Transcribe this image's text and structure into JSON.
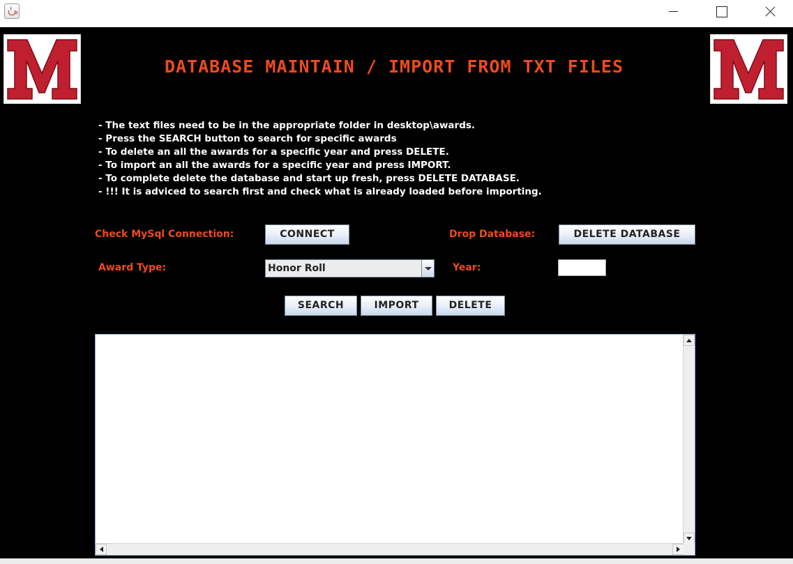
{
  "window": {
    "title": "",
    "controls": [
      "minimize-icon",
      "maximize-icon",
      "close-icon"
    ]
  },
  "colors": {
    "background": "#000000",
    "title": "#ee4b1c",
    "label": "#ee4b1c",
    "instruction_text": "#ffffff",
    "logo_red": "#c01f2f"
  },
  "header": {
    "title": "DATABASE MAINTAIN / IMPORT FROM TXT FILES",
    "logo_letter": "M"
  },
  "instructions": [
    "- The text files need to be in the appropriate folder in desktop\\awards.",
    "- Press the SEARCH button to search for specific awards",
    "- To delete an all the awards for a specific year and press DELETE.",
    "- To import an all the awards for a specific year and press IMPORT.",
    "- To complete delete the database and start up fresh, press DELETE DATABASE.",
    "- !!! It is adviced to search first and check what is already loaded before importing."
  ],
  "form": {
    "connection_label": "Check MySql Connection:",
    "connect_button": "CONNECT",
    "drop_label": "Drop Database:",
    "delete_database_button": "DELETE DATABASE",
    "award_type_label": "Award Type:",
    "award_type_value": "Honor Roll",
    "year_label": "Year:",
    "year_value": ""
  },
  "actions": {
    "search": "SEARCH",
    "import": "IMPORT",
    "delete": "DELETE"
  },
  "output": {
    "text": ""
  }
}
